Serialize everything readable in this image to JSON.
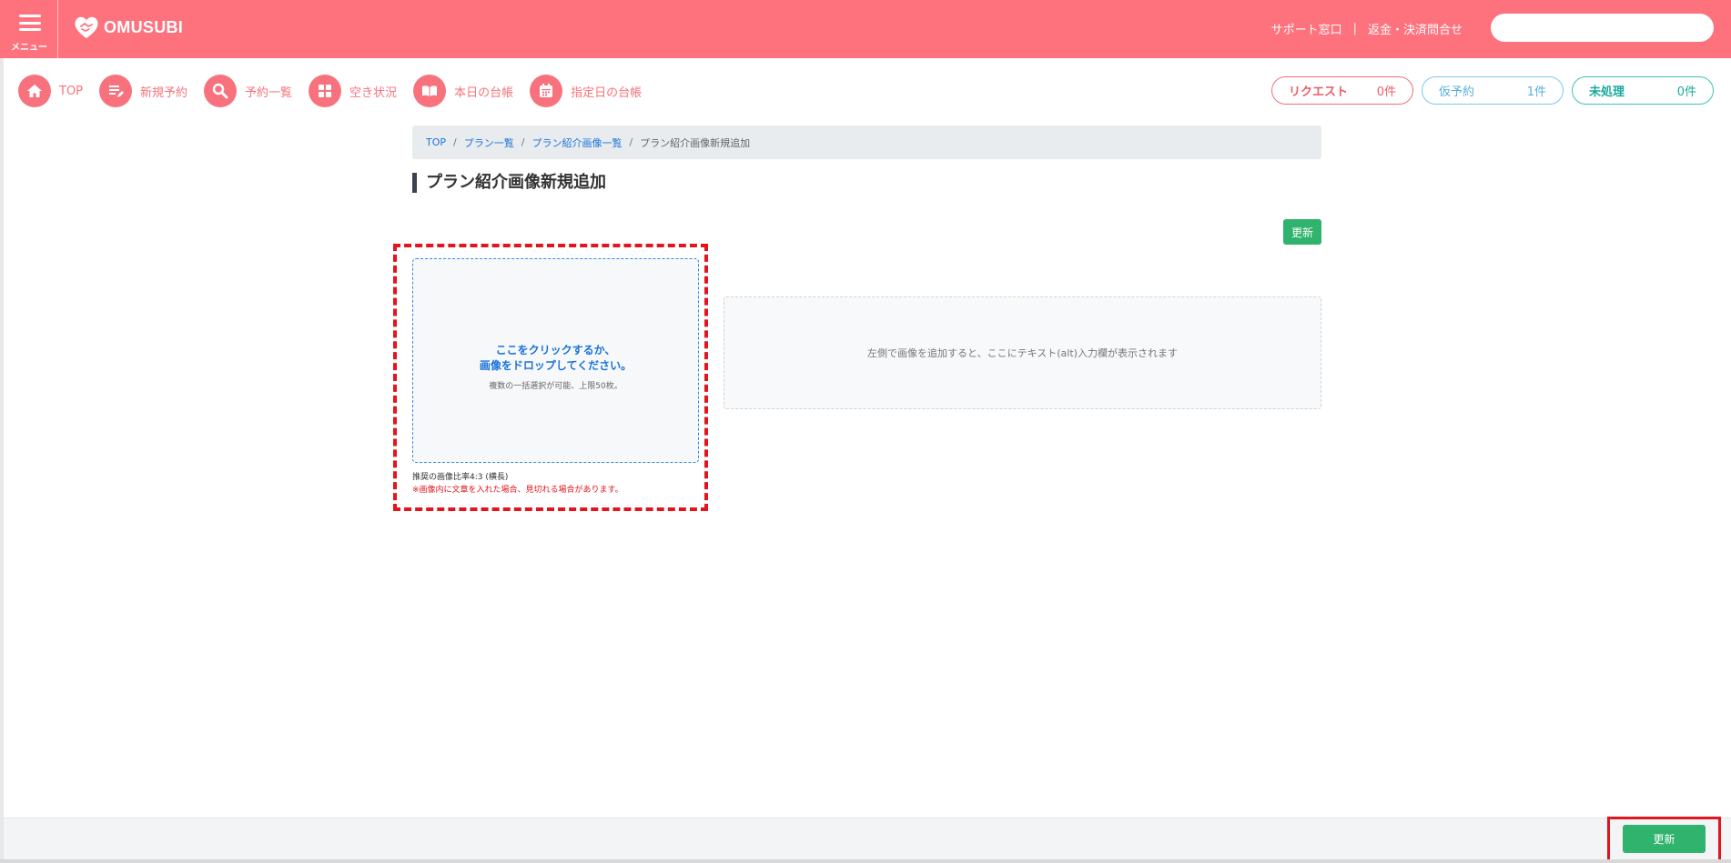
{
  "header": {
    "menu_label": "メニュー",
    "logo_text": "OMUSUBI",
    "support_link": "サポート窓口",
    "separator": "|",
    "refund_link": "返金・決済問合せ",
    "search_placeholder": ""
  },
  "nav": {
    "items": [
      {
        "label": "TOP",
        "icon": "home-icon"
      },
      {
        "label": "新規予約",
        "icon": "new-reservation-icon"
      },
      {
        "label": "予約一覧",
        "icon": "search-icon"
      },
      {
        "label": "空き状況",
        "icon": "grid-icon"
      },
      {
        "label": "本日の台帳",
        "icon": "book-icon"
      },
      {
        "label": "指定日の台帳",
        "icon": "calendar-icon"
      }
    ]
  },
  "status": {
    "request_label": "リクエスト",
    "request_count": "0件",
    "provisional_label": "仮予約",
    "provisional_count": "1件",
    "unprocessed_label": "未処理",
    "unprocessed_count": "0件"
  },
  "breadcrumb": {
    "top": "TOP",
    "sep": "/",
    "plan_list": "プラン一覧",
    "image_list": "プラン紹介画像一覧",
    "current": "プラン紹介画像新規追加"
  },
  "page": {
    "title": "プラン紹介画像新規追加",
    "update_label": "更新"
  },
  "dropzone": {
    "line1": "ここをクリックするか、",
    "line2": "画像をドロップしてください。",
    "sub": "複数の一括選択が可能、上限50枚。",
    "ratio_note": "推奨の画像比率4:3 (横長)",
    "warning": "※画像内に文章を入れた場合、見切れる場合があります。"
  },
  "alt_area": {
    "message": "左側で画像を追加すると、ここにテキスト(alt)入力欄が表示されます"
  },
  "footer": {
    "update_label": "更新"
  },
  "colors": {
    "brand": "#fe727e",
    "nav_accent": "#f8727d",
    "success": "#2fb36d",
    "highlight": "#e3141c"
  }
}
